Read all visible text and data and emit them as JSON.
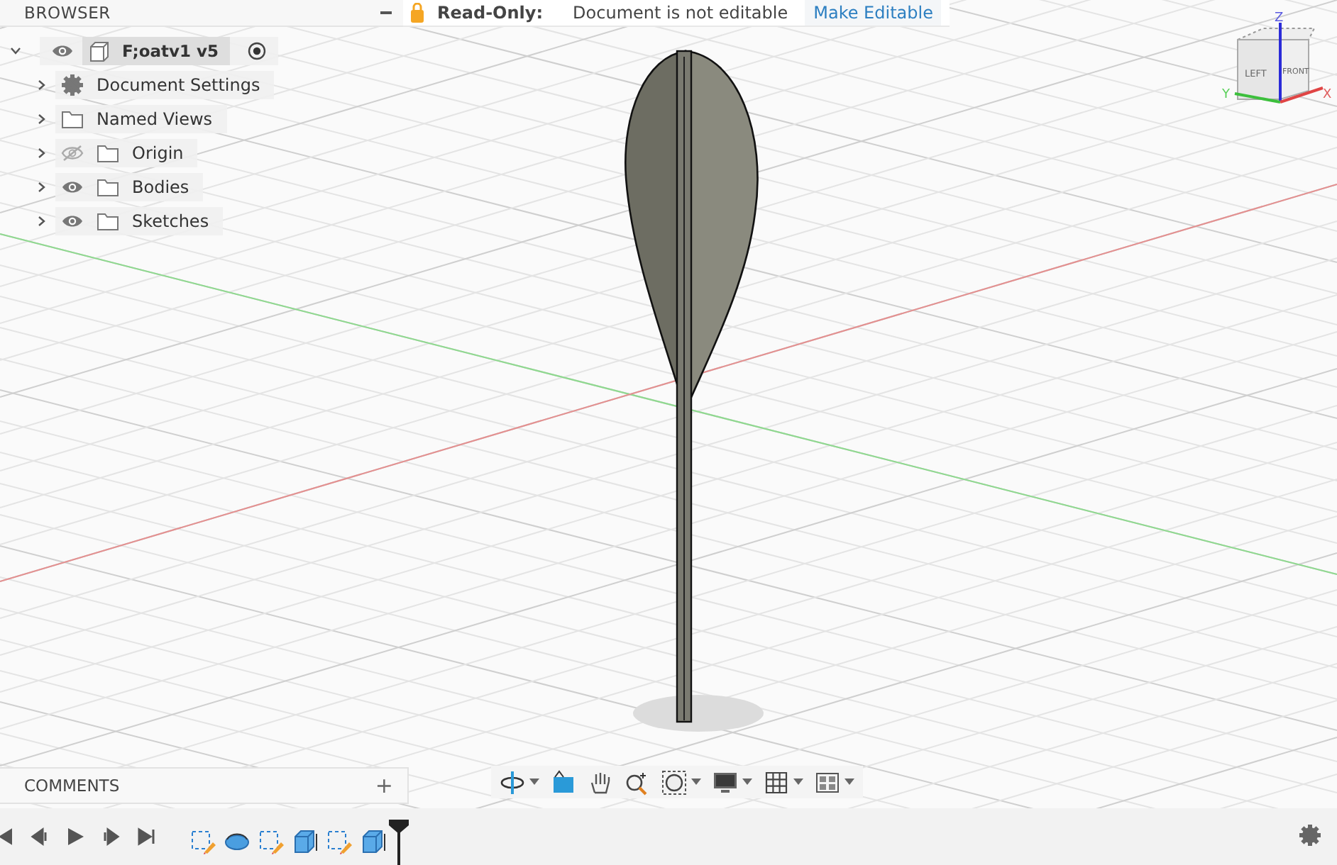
{
  "browser": {
    "title": "BROWSER",
    "tree": {
      "label": "F;oatv1 v5",
      "expanded": true,
      "visible": true,
      "active": true,
      "children": [
        {
          "label": "Document Settings",
          "kind": "settings",
          "expanded": false
        },
        {
          "label": "Named Views",
          "kind": "views",
          "expanded": false
        },
        {
          "label": "Origin",
          "kind": "folder",
          "visible": false,
          "expanded": false
        },
        {
          "label": "Bodies",
          "kind": "folder",
          "visible": true,
          "expanded": false
        },
        {
          "label": "Sketches",
          "kind": "folder",
          "visible": true,
          "expanded": false
        }
      ]
    }
  },
  "banner": {
    "label": "Read-Only:",
    "message": "Document is not editable",
    "action": "Make Editable"
  },
  "viewcube": {
    "left": "LEFT",
    "front": "FRONT",
    "z": "Z",
    "y": "Y",
    "x": "X"
  },
  "comments": {
    "title": "COMMENTS",
    "add": "+"
  },
  "nav_toolbar": [
    {
      "kind": "orbit",
      "dropdown": true
    },
    {
      "kind": "look",
      "dropdown": false
    },
    {
      "kind": "pan",
      "dropdown": false
    },
    {
      "kind": "zoom",
      "dropdown": false
    },
    {
      "kind": "fit",
      "dropdown": true
    },
    {
      "kind": "display",
      "dropdown": true
    },
    {
      "kind": "grid",
      "dropdown": true
    },
    {
      "kind": "viewports",
      "dropdown": true
    }
  ],
  "timeline": {
    "features": [
      {
        "kind": "sketch"
      },
      {
        "kind": "revolve"
      },
      {
        "kind": "sketch"
      },
      {
        "kind": "extrude"
      },
      {
        "kind": "sketch"
      },
      {
        "kind": "extrude"
      }
    ]
  }
}
